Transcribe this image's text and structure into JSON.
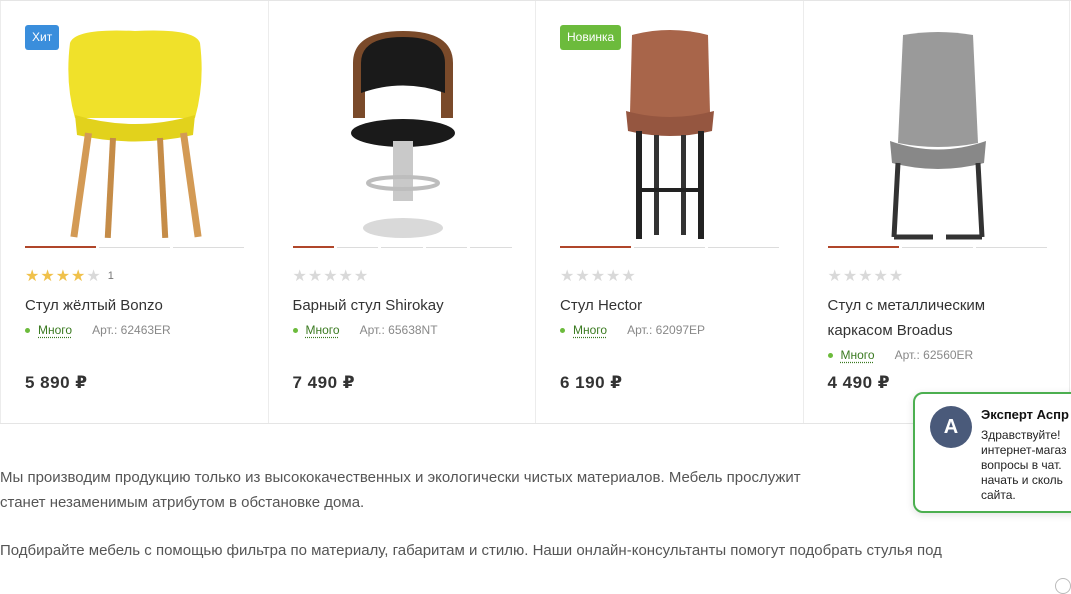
{
  "products": [
    {
      "badge": "Хит",
      "badge_color": "#3a8edc",
      "image_icon": "yellow-chair",
      "rating": 4,
      "reviews": "1",
      "title": "Стул жёлтый Bonzo",
      "stock": "Много",
      "sku": "Арт.: 62463ER",
      "price": "5 890 ₽",
      "active_slide": 0
    },
    {
      "badge": "",
      "image_icon": "bar-stool",
      "rating": 0,
      "reviews": "",
      "title": "Барный стул Shirokay",
      "stock": "Много",
      "sku": "Арт.: 65638NT",
      "price": "7 490 ₽",
      "active_slide": 0
    },
    {
      "badge": "Новинка",
      "badge_color": "#6cbb3c",
      "image_icon": "brown-bar-chair",
      "rating": 0,
      "reviews": "",
      "title": "Стул Hector",
      "stock": "Много",
      "sku": "Арт.: 62097EP",
      "price": "6 190 ₽",
      "active_slide": 0
    },
    {
      "badge": "",
      "image_icon": "gray-chair",
      "rating": 0,
      "reviews": "",
      "title": "Стул с металлическим каркасом Broadus",
      "stock": "Много",
      "sku": "Арт.: 62560ER",
      "price": "4 490 ₽",
      "active_slide": 0
    }
  ],
  "description": {
    "p1_line1": "Мы производим продукцию только из высококачественных и экологически чистых материалов. Мебель прослужит",
    "p1_line2": "станет незаменимым атрибутом в обстановке дома.",
    "p2": "Подбирайте мебель с помощью фильтра по материалу, габаритам и стилю. Наши онлайн-консультанты помогут подобрать стулья под"
  },
  "chat": {
    "avatar_letter": "A",
    "name": "Эксперт Аспр",
    "message": "Здравствуйте!\nинтернет-магаз\nвопросы в чат.\nначать и сколь\nсайта."
  }
}
